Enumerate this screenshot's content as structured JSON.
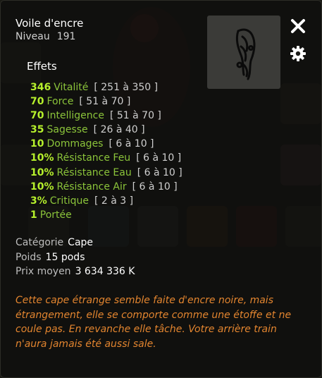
{
  "item": {
    "name": "Voile d'encre",
    "level_label": "Niveau",
    "level_value": "191"
  },
  "effects_title": "Effets",
  "effects": [
    {
      "value": "346",
      "name": "Vitalité",
      "range": "[ 251 à 350 ]"
    },
    {
      "value": "70",
      "name": "Force",
      "range": "[ 51 à 70 ]"
    },
    {
      "value": "70",
      "name": "Intelligence",
      "range": "[ 51 à 70 ]"
    },
    {
      "value": "35",
      "name": "Sagesse",
      "range": "[ 26 à 40 ]"
    },
    {
      "value": "10",
      "name": "Dommages",
      "range": "[ 6 à 10 ]"
    },
    {
      "value": "10%",
      "name": "Résistance Feu",
      "range": "[ 6 à 10 ]"
    },
    {
      "value": "10%",
      "name": "Résistance Eau",
      "range": "[ 6 à 10 ]"
    },
    {
      "value": "10%",
      "name": "Résistance Air",
      "range": "[ 6 à 10 ]"
    },
    {
      "value": "3%",
      "name": "Critique",
      "range": "[ 2 à 3 ]"
    },
    {
      "value": "1",
      "name": "Portée",
      "range": ""
    }
  ],
  "details": {
    "category_label": "Catégorie",
    "category_value": "Cape",
    "weight_label": "Poids",
    "weight_value": "15 pods",
    "price_label": "Prix moyen",
    "price_value": "3 634 336 K"
  },
  "description": "Cette cape étrange semble faite d'encre noire, mais étrangement, elle se comporte comme une étoffe et ne coule pas. En revanche elle tâche. Votre arrière train n'aura jamais été aussi sale.",
  "icons": {
    "close": "close-icon",
    "settings": "gear-icon",
    "item": "ink-cape-icon"
  },
  "colors": {
    "effect_value": "#b6f02c",
    "effect_name": "#8bc43a",
    "description": "#e3852f"
  }
}
